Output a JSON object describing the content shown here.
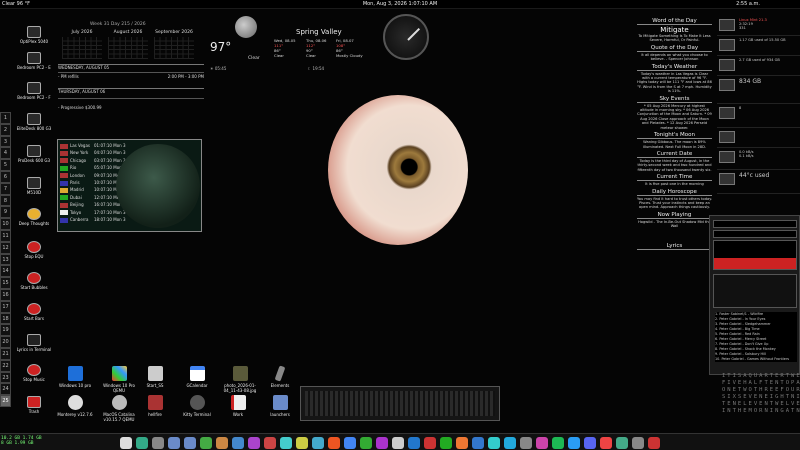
{
  "topbar": {
    "left": "Clear 96 °F",
    "center": "Mon, Aug 3, 2026 1:07:10 AM",
    "right": "2:55 a.m."
  },
  "desktop_icons": [
    {
      "label": "OptiPlex 5040"
    },
    {
      "label": "Bedroom PC2 - E"
    },
    {
      "label": "Bedroom PC2 - F"
    },
    {
      "label": "EliteDesk 800 G3"
    },
    {
      "label": "ProDesk 600 G3"
    },
    {
      "label": "M510D"
    },
    {
      "label": "Deep Thoughts"
    },
    {
      "label": "Stop EQU"
    },
    {
      "label": "Start Bubbles"
    },
    {
      "label": "Start Bars"
    },
    {
      "label": "Lyrics in Terminal"
    },
    {
      "label": "Stop Music"
    },
    {
      "label": "Trash"
    }
  ],
  "workspaces": [
    "1",
    "2",
    "3",
    "4",
    "5",
    "6",
    "7",
    "8",
    "9",
    "10",
    "11",
    "12",
    "13",
    "14",
    "15",
    "16",
    "17",
    "18",
    "19",
    "20",
    "21",
    "22",
    "23",
    "24",
    "25"
  ],
  "calendar": {
    "header": "Week 31 Day 215 / 2026",
    "months": [
      "July 2026",
      "August 2026",
      "September 2026"
    ]
  },
  "events": [
    {
      "date": "WEDNESDAY, AUGUST 05",
      "text": "- PM refills",
      "time": "2:00 PM - 3:00 PM"
    },
    {
      "date": "THURSDAY, AUGUST 06",
      "text": "- Progressive $300.99",
      "time": ""
    }
  ],
  "world_clock": [
    {
      "city": "Las Vegas",
      "time": "01:07:10 Mon 3"
    },
    {
      "city": "New York",
      "time": "04:07:10 Mon 3"
    },
    {
      "city": "Chicago",
      "time": "03:07:10 Mon 3"
    },
    {
      "city": "Rio",
      "time": "05:07:10 Mon 3"
    },
    {
      "city": "London",
      "time": "09:07:10 Mon 3"
    },
    {
      "city": "Paris",
      "time": "10:07:10 Mon 3"
    },
    {
      "city": "Madrid",
      "time": "10:07:10 Mon 3"
    },
    {
      "city": "Dubai",
      "time": "12:07:10 Mon 3"
    },
    {
      "city": "Beijing",
      "time": "16:07:10 Mon 3"
    },
    {
      "city": "Tokyo",
      "time": "17:07:10 Mon 3"
    },
    {
      "city": "Canberra",
      "time": "18:07:10 Mon 3"
    }
  ],
  "weather": {
    "temp": "97°",
    "condition": "Clear",
    "location": "Spring Valley",
    "forecast": [
      {
        "day": "Wed, 08.05",
        "hi": "111°",
        "lo": "86°",
        "desc": "Clear"
      },
      {
        "day": "Thu, 08.06",
        "hi": "112°",
        "lo": "90°",
        "desc": "Clear"
      },
      {
        "day": "Fri, 08.07",
        "hi": "108°",
        "lo": "86°",
        "desc": "Mostly Cloudy"
      }
    ],
    "sunrise": "05:45",
    "sunset": "19:54"
  },
  "right_panel": {
    "word_title": "Word of the Day",
    "word": "Mitigate",
    "word_def": "To Mitigate Something Is To Make It Less Severe, Harmful, Or Painful.",
    "quote_title": "Quote of the Day",
    "quote": "It all depends on what you choose to believe. - Spencer Johnson",
    "weather_title": "Today's Weather",
    "weather_text": "Today's weather in Las Vegas is Clear with a current temperature of 96 °F. Highs today will be 111 °F and lows at 86 °F. Wind is from the S at 7 mph. Humidity is 11%.",
    "sky_title": "Sky Events",
    "sky_text": "* 05 Aug 2026 Mercury at highest altitude in morning sky. * 06 Aug 2026 Conjunction of the Moon and Saturn. * 09 Aug 2026 Close approach of the Moon and Pleiades. * 12 Aug 2026 Perseid meteor shower.",
    "moon_title": "Tonight's Moon",
    "moon_text": "Waning Gibbous. The moon is 89% illuminated. Next Full Moon in 28D.",
    "date_title": "Current Date",
    "date_text": "Today is the third day of August, in the thirty-second week and two hundred and fifteenth day of two thousand twenty six.",
    "time_title": "Current Time",
    "time_text": "It is five past one in the morning",
    "horo_title": "Daily Horoscope",
    "horo_text": "You may find it hard to trust others today. Pisces. Trust your instincts and keep an open mind. Approach things cautiously.",
    "np_title": "Now Playing",
    "np_text": "Hogwild - The In-Be-Out Shadow Mid the Wall",
    "lyrics_title": "Lyrics"
  },
  "system": {
    "os": "Linux Mint 21.3",
    "uptime": "2:32:19",
    "processes": "331",
    "cores": "8",
    "mem": "1.17 GB used of 15.50 GB",
    "disk1": "2.7 GB used of 934 GB",
    "disk2": "834 GB",
    "net_up": "0.0 kB/s",
    "net_down": "0.1 kB/s",
    "temp": "44°c used"
  },
  "playlist": [
    "1. Faster Sabinet/1 - Wildfire",
    "2. Peter Gabriel - In Your Eyes",
    "3. Peter Gabriel - Sledgehammer",
    "4. Peter Gabriel - Big Time",
    "5. Peter Gabriel - Red Rain",
    "6. Peter Gabriel - Mercy Street",
    "7. Peter Gabriel - Don't Give Up",
    "8. Peter Gabriel - Shock the Monkey",
    "9. Peter Gabriel - Solsbury Hill",
    "10. Peter Gabriel - Games Without Frontiers"
  ],
  "wordclock": [
    "ITISAQUARTERTWENTY",
    "FIVEHALFTENTOPAST",
    "ONETWOTHREEFOURFIVE",
    "SIXSEVENEIGHTNINE",
    "TENELEVENTWELVE",
    "INTHEMORNINGATNIGHT"
  ],
  "apps": [
    {
      "label": "Windows 10 pro"
    },
    {
      "label": "Windows 10 Pro QEMU"
    },
    {
      "label": "Start_SS"
    },
    {
      "label": "GCalendar"
    },
    {
      "label": "photo_2026-01-04_11-43-08.jpg"
    },
    {
      "label": "Elements"
    },
    {
      "label": "Monterey v12.7.6"
    },
    {
      "label": "MacOS Catalina v10.15.7 QEMU"
    },
    {
      "label": "hellfire"
    },
    {
      "label": "Kitty Terminal"
    },
    {
      "label": "Work"
    },
    {
      "label": "launchers"
    }
  ],
  "dock": {
    "cpu_l1": "10.2 GB   1.74 GB",
    "cpu_l2": "8 GB       1.99 GB"
  },
  "colors": {
    "bg": "#050505",
    "accent": "#e33",
    "text": "#ddd"
  }
}
